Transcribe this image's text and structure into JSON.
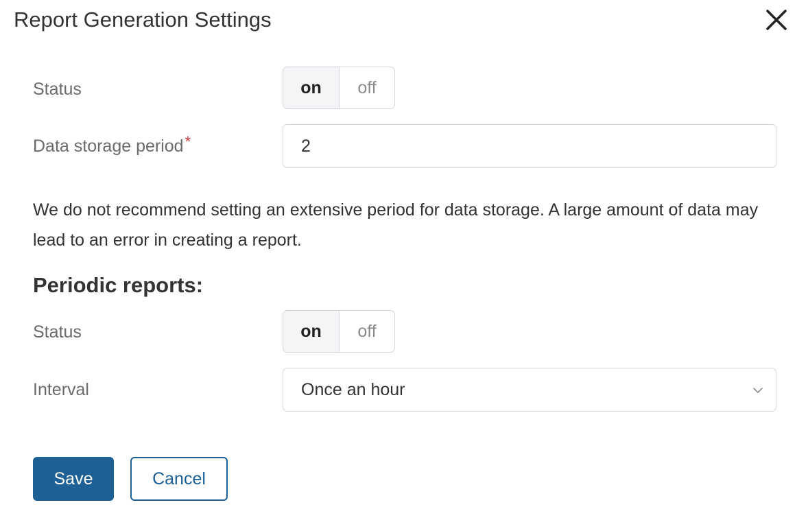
{
  "dialog": {
    "title": "Report Generation Settings",
    "close_icon": "close-icon"
  },
  "report_settings": {
    "status_label": "Status",
    "status_on": "on",
    "status_off": "off",
    "status_selected": "on",
    "storage_label": "Data storage period",
    "storage_required_mark": "*",
    "storage_value": "2",
    "hint": "We do not recommend setting an extensive period for data storage. A large amount of data may lead to an error in creating a report."
  },
  "periodic_reports": {
    "heading": "Periodic reports:",
    "status_label": "Status",
    "status_on": "on",
    "status_off": "off",
    "status_selected": "on",
    "interval_label": "Interval",
    "interval_value": "Once an hour",
    "interval_icon": "chevron-down-icon"
  },
  "actions": {
    "save_label": "Save",
    "cancel_label": "Cancel"
  },
  "colors": {
    "primary": "#1d6096",
    "required": "#d6363a",
    "border": "#d4d7db",
    "label": "#6b6b6b"
  }
}
